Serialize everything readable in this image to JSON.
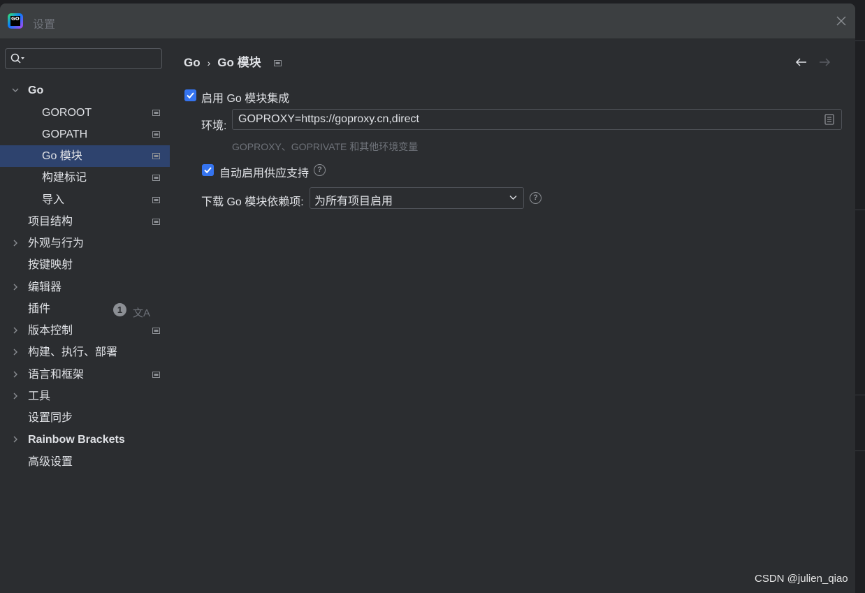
{
  "window": {
    "title": "设置"
  },
  "search": {
    "placeholder": ""
  },
  "sidebar": {
    "items": [
      {
        "label": "Go",
        "expanded": true
      },
      {
        "label": "GOROOT"
      },
      {
        "label": "GOPATH"
      },
      {
        "label": "Go 模块",
        "selected": true
      },
      {
        "label": "构建标记"
      },
      {
        "label": "导入"
      },
      {
        "label": "项目结构"
      },
      {
        "label": "外观与行为"
      },
      {
        "label": "按键映射"
      },
      {
        "label": "编辑器"
      },
      {
        "label": "插件",
        "badge": "1"
      },
      {
        "label": "版本控制"
      },
      {
        "label": "构建、执行、部署"
      },
      {
        "label": "语言和框架"
      },
      {
        "label": "工具"
      },
      {
        "label": "设置同步"
      },
      {
        "label": "Rainbow Brackets"
      },
      {
        "label": "高级设置"
      }
    ]
  },
  "breadcrumb": {
    "parent": "Go",
    "sep": "›",
    "current": "Go 模块"
  },
  "main": {
    "enable_modules_label": "启用 Go 模块集成",
    "env_label": "环境:",
    "env_value": "GOPROXY=https://goproxy.cn,direct",
    "env_hint": "GOPROXY、GOPRIVATE 和其他环境变量",
    "vendoring_label": "自动启用供应支持",
    "download_label": "下载 Go 模块依赖项:",
    "download_value": "为所有项目启用"
  },
  "checkboxes": {
    "enable_modules": true,
    "vendoring": true
  },
  "watermark": "CSDN @julien_qiao",
  "colors": {
    "accent": "#3574f0",
    "selection": "#2e436e",
    "background": "#2b2d30"
  }
}
